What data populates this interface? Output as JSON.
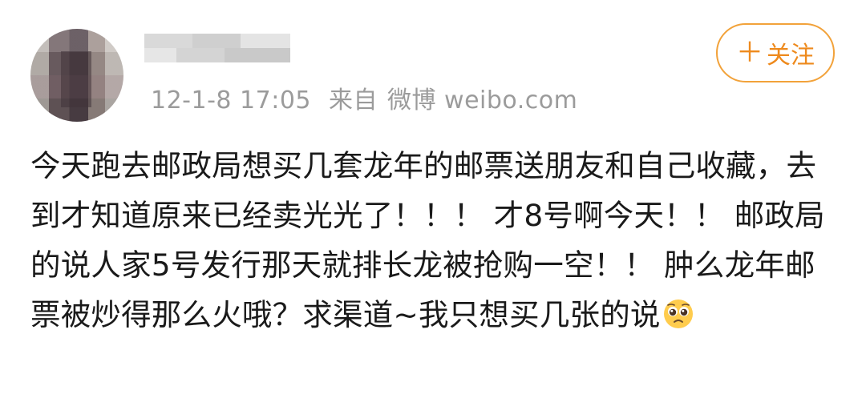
{
  "post": {
    "username": "",
    "timestamp": "12-1-8 17:05",
    "source_label": "来自",
    "source_value": "微博 weibo.com",
    "follow_label": "关注",
    "text": "今天跑去邮政局想买几套龙年的邮票送朋友和自己收藏，去到才知道原来已经卖光光了！！！ 才8号啊今天！！ 邮政局的说人家5号发行那天就排长龙被抢购一空！！ 肿么龙年邮票被炒得那么火哦？求渠道~我只想买几张的说",
    "emoji": "pleading-face-icon"
  },
  "colors": {
    "accent": "#ee8a1d",
    "meta_text": "#9b9b9b",
    "body_text": "#1a1a1a"
  }
}
